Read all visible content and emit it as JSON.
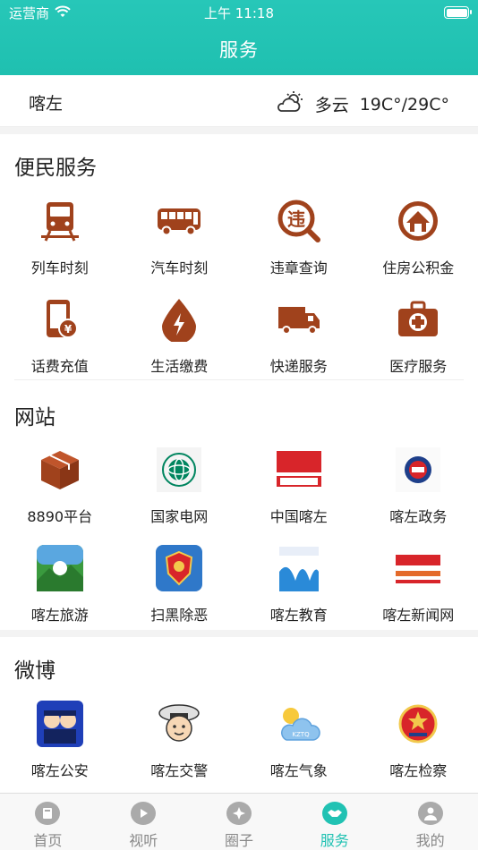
{
  "status_bar": {
    "carrier": "运营商",
    "time": "上午 11:18"
  },
  "header": {
    "title": "服务"
  },
  "weather": {
    "city": "喀左",
    "condition": "多云",
    "temperature": "19C°/29C°",
    "icon": "partly-cloudy-icon"
  },
  "sections": {
    "convenience": {
      "title": "便民服务",
      "items": [
        {
          "label": "列车时刻",
          "icon": "train-icon"
        },
        {
          "label": "汽车时刻",
          "icon": "bus-icon"
        },
        {
          "label": "违章查询",
          "icon": "violation-search-icon"
        },
        {
          "label": "住房公积金",
          "icon": "housing-fund-icon"
        },
        {
          "label": "话费充值",
          "icon": "phone-recharge-icon"
        },
        {
          "label": "生活缴费",
          "icon": "utility-payment-icon"
        },
        {
          "label": "快递服务",
          "icon": "delivery-truck-icon"
        },
        {
          "label": "医疗服务",
          "icon": "medical-kit-icon"
        }
      ]
    },
    "websites": {
      "title": "网站",
      "items": [
        {
          "label": "8890平台",
          "icon": "box-icon"
        },
        {
          "label": "国家电网",
          "icon": "state-grid-logo-icon"
        },
        {
          "label": "中国喀左",
          "icon": "china-kazuo-logo-icon"
        },
        {
          "label": "喀左政务",
          "icon": "kazuo-government-logo-icon"
        },
        {
          "label": "喀左旅游",
          "icon": "kazuo-tourism-logo-icon"
        },
        {
          "label": "扫黑除恶",
          "icon": "police-emblem-icon"
        },
        {
          "label": "喀左教育",
          "icon": "education-cloud-logo-icon"
        },
        {
          "label": "喀左新闻网",
          "icon": "kazuo-news-logo-icon"
        }
      ]
    },
    "weibo": {
      "title": "微博",
      "items": [
        {
          "label": "喀左公安",
          "icon": "police-cartoon-icon"
        },
        {
          "label": "喀左交警",
          "icon": "traffic-police-cartoon-icon"
        },
        {
          "label": "喀左气象",
          "icon": "weather-cloud-icon"
        },
        {
          "label": "喀左检察",
          "icon": "procuratorate-emblem-icon"
        }
      ]
    }
  },
  "tabbar": {
    "items": [
      {
        "label": "首页",
        "icon": "home-icon"
      },
      {
        "label": "视听",
        "icon": "play-icon"
      },
      {
        "label": "圈子",
        "icon": "circle-icon"
      },
      {
        "label": "服务",
        "icon": "handshake-icon",
        "active": true
      },
      {
        "label": "我的",
        "icon": "user-icon"
      }
    ]
  },
  "colors": {
    "accent": "#21c2b3",
    "icon_brown": "#a0421c"
  }
}
